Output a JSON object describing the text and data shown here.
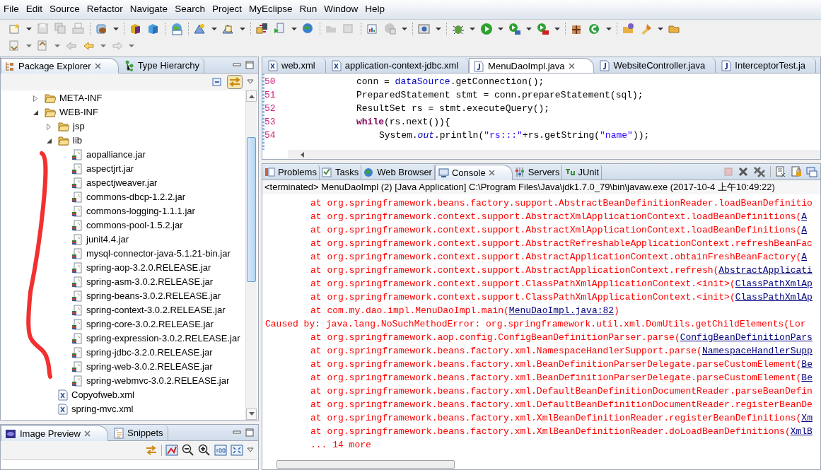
{
  "menu": [
    "File",
    "Edit",
    "Source",
    "Refactor",
    "Navigate",
    "Search",
    "Project",
    "MyEclipse",
    "Run",
    "Window",
    "Help"
  ],
  "left_view": {
    "tabs": [
      {
        "label": "Package Explorer",
        "selected": true
      },
      {
        "label": "Type Hierarchy",
        "selected": false
      }
    ],
    "tree": [
      {
        "label": "META-INF",
        "kind": "folder",
        "expanded": false
      },
      {
        "label": "WEB-INF",
        "kind": "folder",
        "expanded": true,
        "children": [
          {
            "label": "jsp",
            "kind": "folder",
            "expanded": false
          },
          {
            "label": "lib",
            "kind": "folder",
            "expanded": true,
            "children": [
              {
                "label": "aopalliance.jar",
                "kind": "jar"
              },
              {
                "label": "aspectjrt.jar",
                "kind": "jar"
              },
              {
                "label": "aspectjweaver.jar",
                "kind": "jar"
              },
              {
                "label": "commons-dbcp-1.2.2.jar",
                "kind": "jar"
              },
              {
                "label": "commons-logging-1.1.1.jar",
                "kind": "jar"
              },
              {
                "label": "commons-pool-1.5.2.jar",
                "kind": "jar"
              },
              {
                "label": "junit4.4.jar",
                "kind": "jar"
              },
              {
                "label": "mysql-connector-java-5.1.21-bin.jar",
                "kind": "jar"
              },
              {
                "label": "spring-aop-3.2.0.RELEASE.jar",
                "kind": "jar"
              },
              {
                "label": "spring-asm-3.0.2.RELEASE.jar",
                "kind": "jar"
              },
              {
                "label": "spring-beans-3.0.2.RELEASE.jar",
                "kind": "jar"
              },
              {
                "label": "spring-context-3.0.2.RELEASE.jar",
                "kind": "jar"
              },
              {
                "label": "spring-core-3.0.2.RELEASE.jar",
                "kind": "jar"
              },
              {
                "label": "spring-expression-3.0.2.RELEASE.jar",
                "kind": "jar"
              },
              {
                "label": "spring-jdbc-3.2.0.RELEASE.jar",
                "kind": "jar"
              },
              {
                "label": "spring-web-3.0.2.RELEASE.jar",
                "kind": "jar"
              },
              {
                "label": "spring-webmvc-3.0.2.RELEASE.jar",
                "kind": "jar"
              }
            ]
          },
          {
            "label": "Copyofweb.xml",
            "kind": "xml"
          },
          {
            "label": "spring-mvc.xml",
            "kind": "xml"
          }
        ]
      }
    ]
  },
  "bottom_view": {
    "tabs": [
      {
        "label": "Image Preview",
        "selected": true
      },
      {
        "label": "Snippets",
        "selected": false
      }
    ]
  },
  "editor": {
    "tabs": [
      {
        "label": "web.xml",
        "kind": "xml",
        "selected": false
      },
      {
        "label": "application-context-jdbc.xml",
        "kind": "xml",
        "selected": false
      },
      {
        "label": "MenuDaoImpl.java",
        "kind": "java",
        "selected": true
      },
      {
        "label": "WebsiteController.java",
        "kind": "java",
        "selected": false
      },
      {
        "label": "InterceptorTest.ja",
        "kind": "java",
        "selected": false
      }
    ],
    "lines": [
      {
        "number": "50",
        "tokens": [
          {
            "text": "conn = ",
            "kind": "plain"
          },
          {
            "text": "dataSource",
            "kind": "field"
          },
          {
            "text": ".getConnection();",
            "kind": "plain"
          }
        ]
      },
      {
        "number": "51",
        "tokens": [
          {
            "text": "PreparedStatement stmt = conn.prepareStatement(sql);",
            "kind": "plain"
          }
        ]
      },
      {
        "number": "52",
        "tokens": [
          {
            "text": "ResultSet rs = stmt.executeQuery();",
            "kind": "plain"
          }
        ]
      },
      {
        "number": "53",
        "tokens": [
          {
            "text": "while",
            "kind": "keyword"
          },
          {
            "text": "(rs.next()){",
            "kind": "plain"
          }
        ],
        "children": [
          {
            "number": "54",
            "tokens": [
              {
                "text": "System.",
                "kind": "plain"
              },
              {
                "text": "out",
                "kind": "static"
              },
              {
                "text": ".println(",
                "kind": "plain"
              },
              {
                "text": "\"rs:::\"",
                "kind": "string"
              },
              {
                "text": "+rs.getString(",
                "kind": "plain"
              },
              {
                "text": "\"name\"",
                "kind": "string"
              },
              {
                "text": "));",
                "kind": "plain"
              }
            ]
          }
        ]
      }
    ]
  },
  "console": {
    "tabs": [
      {
        "label": "Problems",
        "selected": false
      },
      {
        "label": "Tasks",
        "selected": false
      },
      {
        "label": "Web Browser",
        "selected": false
      },
      {
        "label": "Console",
        "selected": true
      },
      {
        "label": "Servers",
        "selected": false
      },
      {
        "label": "JUnit",
        "selected": false
      }
    ],
    "header": "<terminated> MenuDaoImpl (2) [Java Application] C:\\Program Files\\Java\\jdk1.7.0_79\\bin\\javaw.exe (2017-10-4 上午10:49:22)",
    "lines": [
      {
        "kind": "frame",
        "text": "at org.springframework.beans.factory.support.AbstractBeanDefinitionReader.loadBeanDefinitio"
      },
      {
        "kind": "frame",
        "text": "at org.springframework.context.support.AbstractXmlApplicationContext.loadBeanDefinitions(",
        "link": "A"
      },
      {
        "kind": "frame",
        "text": "at org.springframework.context.support.AbstractXmlApplicationContext.loadBeanDefinitions(",
        "link": "A"
      },
      {
        "kind": "frame",
        "text": "at org.springframework.context.support.AbstractRefreshableApplicationContext.refreshBeanFac"
      },
      {
        "kind": "frame",
        "text": "at org.springframework.context.support.AbstractApplicationContext.obtainFreshBeanFactory(",
        "link": "A"
      },
      {
        "kind": "frame",
        "text": "at org.springframework.context.support.AbstractApplicationContext.refresh(",
        "link": "AbstractApplicati"
      },
      {
        "kind": "frame",
        "text": "at org.springframework.context.support.ClassPathXmlApplicationContext.<init>(",
        "link": "ClassPathXmlAp"
      },
      {
        "kind": "frame",
        "text": "at org.springframework.context.support.ClassPathXmlApplicationContext.<init>(",
        "link": "ClassPathXmlAp"
      },
      {
        "kind": "frame",
        "text": "at com.my.dao.impl.MenuDaoImpl.main(",
        "link": "MenuDaoImpl.java:82",
        "tail": ")"
      },
      {
        "kind": "cause",
        "text": "Caused by: java.lang.NoSuchMethodError: org.springframework.util.xml.DomUtils.getChildElements(Lor"
      },
      {
        "kind": "frame",
        "text": "at org.springframework.aop.config.ConfigBeanDefinitionParser.parse(",
        "link": "ConfigBeanDefinitionPars"
      },
      {
        "kind": "frame",
        "text": "at org.springframework.beans.factory.xml.NamespaceHandlerSupport.parse(",
        "link": "NamespaceHandlerSupp"
      },
      {
        "kind": "frame",
        "text": "at org.springframework.beans.factory.xml.BeanDefinitionParserDelegate.parseCustomElement(",
        "link": "Be"
      },
      {
        "kind": "frame",
        "text": "at org.springframework.beans.factory.xml.BeanDefinitionParserDelegate.parseCustomElement(",
        "link": "Be"
      },
      {
        "kind": "frame",
        "text": "at org.springframework.beans.factory.xml.DefaultBeanDefinitionDocumentReader.parseBeanDefin"
      },
      {
        "kind": "frame",
        "text": "at org.springframework.beans.factory.xml.DefaultBeanDefinitionDocumentReader.registerBeanDe"
      },
      {
        "kind": "frame",
        "text": "at org.springframework.beans.factory.xml.XmlBeanDefinitionReader.registerBeanDefinitions(",
        "link": "Xm"
      },
      {
        "kind": "frame",
        "text": "at org.springframework.beans.factory.xml.XmlBeanDefinitionReader.doLoadBeanDefinitions(",
        "link": "XmlB"
      },
      {
        "kind": "frame",
        "text": "... 14 more"
      }
    ]
  }
}
